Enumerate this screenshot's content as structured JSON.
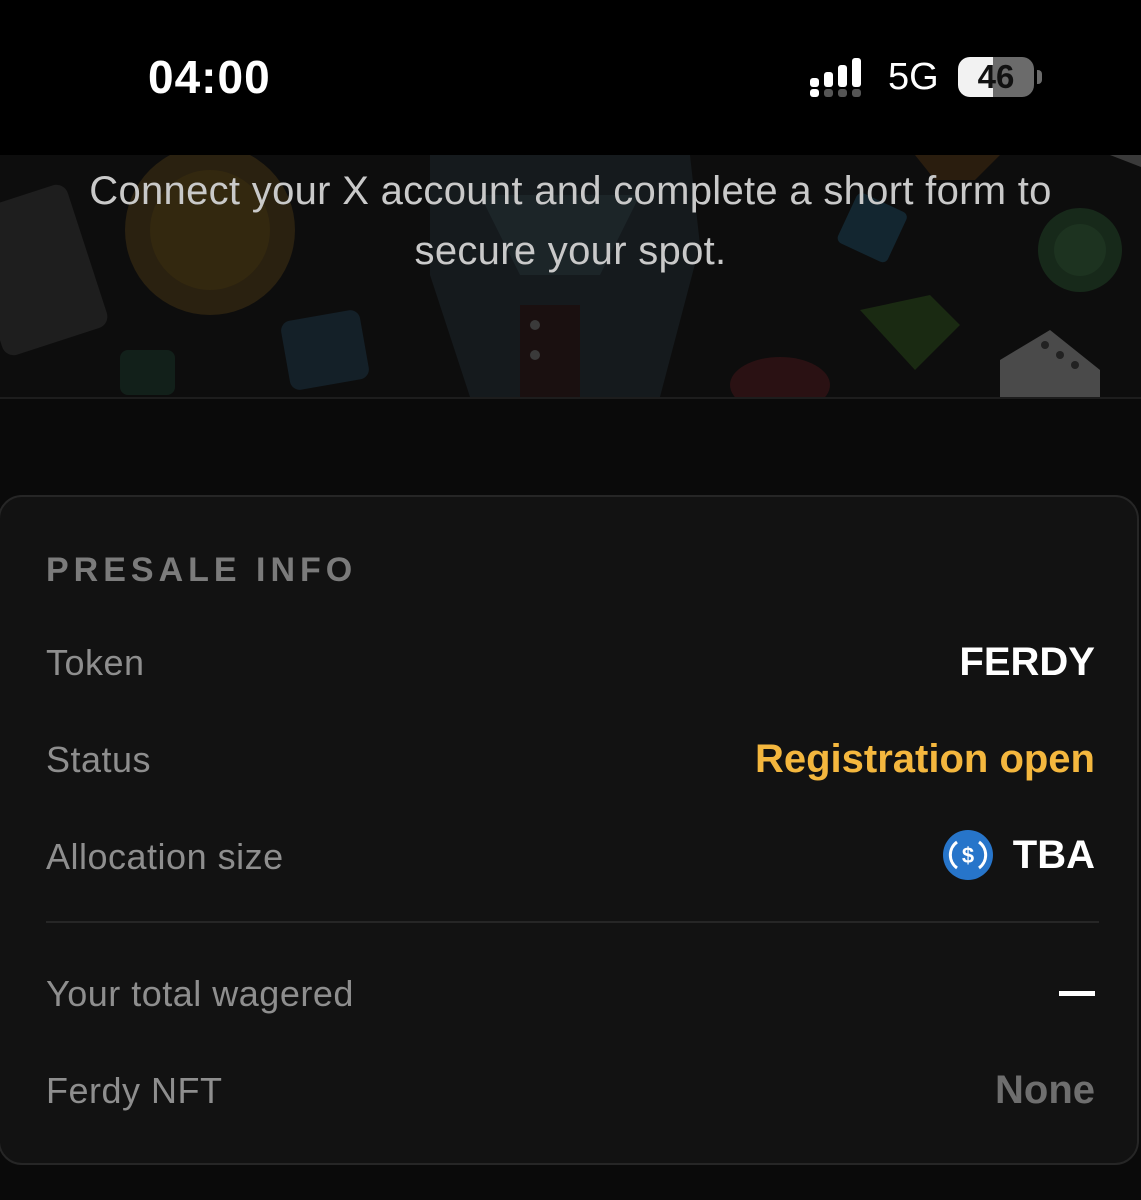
{
  "status_bar": {
    "time": "04:00",
    "network": "5G",
    "battery": "46"
  },
  "hero": {
    "text": "Connect your X account and complete a short form to secure your spot."
  },
  "presale": {
    "heading": "PRESALE INFO",
    "rows": [
      {
        "label": "Token",
        "value": "FERDY"
      },
      {
        "label": "Status",
        "value": "Registration open"
      },
      {
        "label": "Allocation size",
        "value": "TBA",
        "icon": "usdc-icon"
      },
      {
        "label": "Your total wagered",
        "value": "—"
      },
      {
        "label": "Ferdy NFT",
        "value": "None"
      }
    ]
  },
  "colors": {
    "background": "#0a0a0a",
    "card": "#121212",
    "status_accent": "#f4b73e",
    "usdc_blue": "#2775ca"
  }
}
